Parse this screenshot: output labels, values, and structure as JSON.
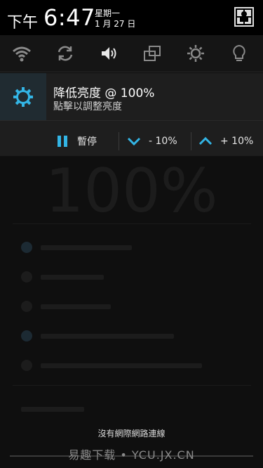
{
  "status_bar": {
    "time_prefix": "下午",
    "time": "6:47",
    "weekday": "星期一",
    "date": "1 月 27 日",
    "profile_icon": "profile-icon"
  },
  "quick_settings": [
    {
      "name": "wifi-icon"
    },
    {
      "name": "sync-icon"
    },
    {
      "name": "sound-icon"
    },
    {
      "name": "screen-rotation-icon"
    },
    {
      "name": "brightness-icon"
    },
    {
      "name": "flashlight-icon"
    }
  ],
  "notification": {
    "icon": "gear-icon",
    "title": "降低亮度 @ 100%",
    "subtitle": "點擊以調整亮度",
    "actions": [
      {
        "label": "暫停",
        "icon": "pause-icon"
      },
      {
        "label": "- 10%",
        "icon": "chevron-down-icon"
      },
      {
        "label": "+ 10%",
        "icon": "chevron-up-icon"
      }
    ]
  },
  "background": {
    "big_value": "100%"
  },
  "footer": {
    "network_message": "沒有網際網路連線",
    "watermark": "易趣下载 • YCU.JX.CN"
  },
  "colors": {
    "accent": "#33b5e5",
    "panel": "#1e1e1e",
    "icon_box": "#202b31"
  }
}
